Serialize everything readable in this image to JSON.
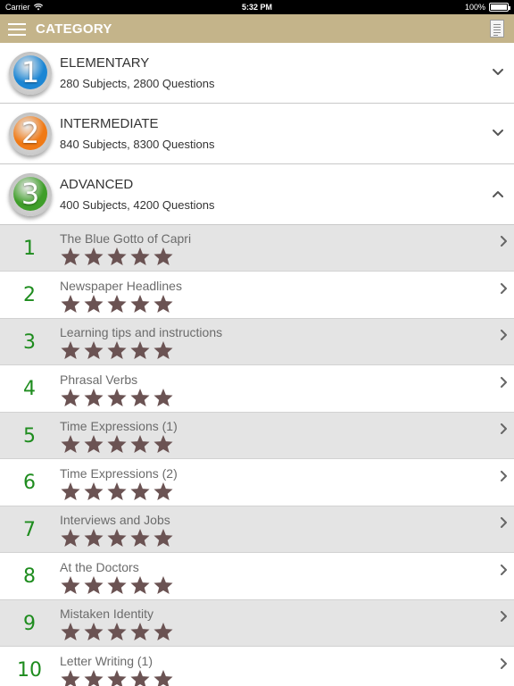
{
  "status_bar": {
    "carrier": "Carrier",
    "time": "5:32 PM",
    "battery": "100%",
    "battery_level": 1.0
  },
  "header": {
    "title": "CATEGORY",
    "menu_icon": "hamburger-menu-icon",
    "right_icon": "document-icon"
  },
  "colors": {
    "header_bg": "#c4b48a",
    "number_green": "#1e8c1e",
    "star_brown": "#6b5353",
    "row_shaded": "#e4e4e4"
  },
  "categories": [
    {
      "number": "1",
      "title": "ELEMENTARY",
      "subtitle": "280 Subjects, 2800 Questions",
      "badge_color": "#1c86d4",
      "expanded": false
    },
    {
      "number": "2",
      "title": "INTERMEDIATE",
      "subtitle": "840 Subjects, 8300 Questions",
      "badge_color": "#f07a16",
      "expanded": false
    },
    {
      "number": "3",
      "title": "ADVANCED",
      "subtitle": "400 Subjects, 4200 Questions",
      "badge_color": "#3f9e2a",
      "expanded": true
    }
  ],
  "subjects": [
    {
      "number": "1",
      "title": "The Blue Gotto of Capri",
      "rating": 5
    },
    {
      "number": "2",
      "title": "Newspaper Headlines",
      "rating": 5
    },
    {
      "number": "3",
      "title": "Learning tips and instructions",
      "rating": 5
    },
    {
      "number": "4",
      "title": "Phrasal Verbs",
      "rating": 5
    },
    {
      "number": "5",
      "title": "Time Expressions (1)",
      "rating": 5
    },
    {
      "number": "6",
      "title": "Time Expressions (2)",
      "rating": 5
    },
    {
      "number": "7",
      "title": "Interviews and Jobs",
      "rating": 5
    },
    {
      "number": "8",
      "title": "At the Doctors",
      "rating": 5
    },
    {
      "number": "9",
      "title": "Mistaken Identity",
      "rating": 5
    },
    {
      "number": "10",
      "title": "Letter Writing (1)",
      "rating": 5
    }
  ]
}
